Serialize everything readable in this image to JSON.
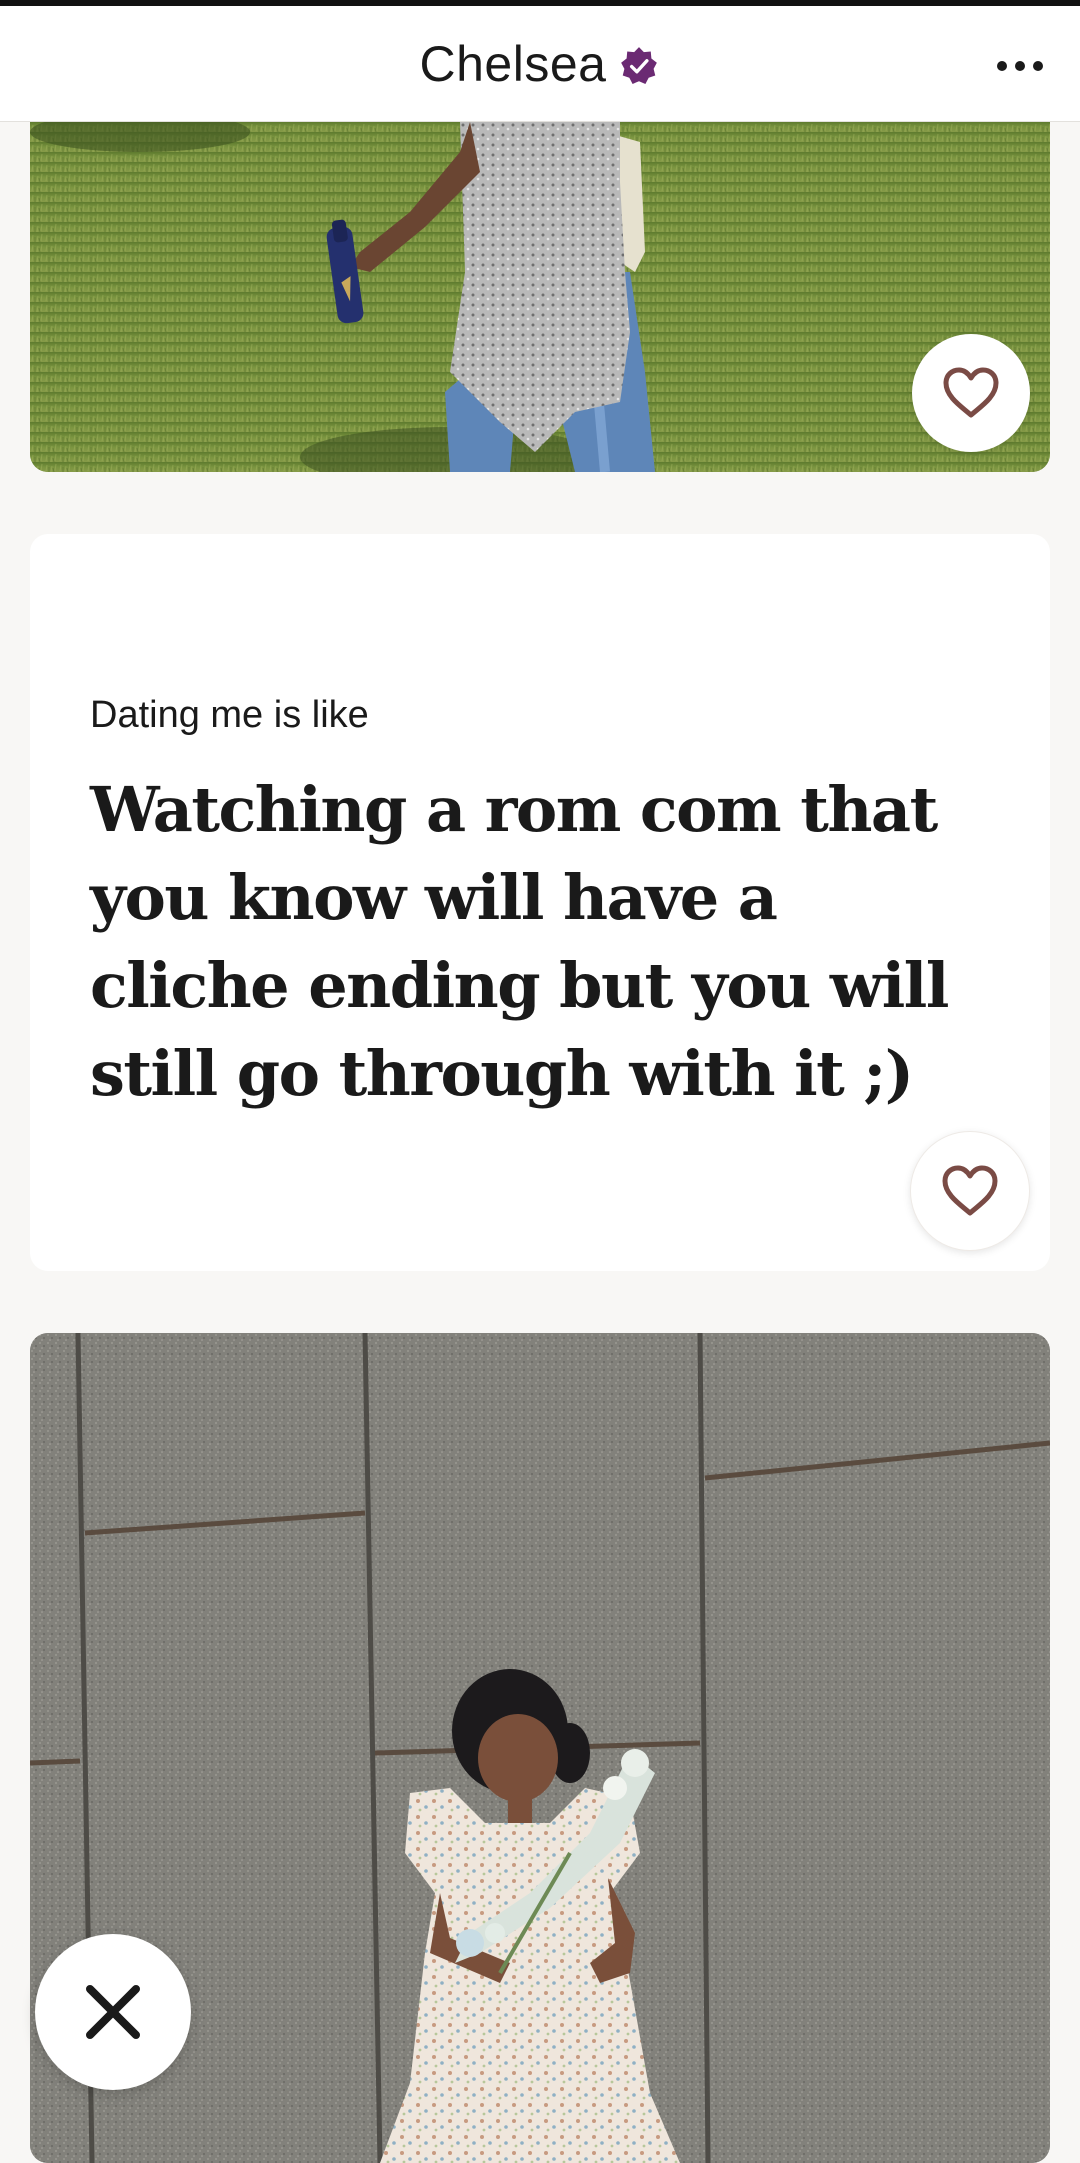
{
  "header": {
    "name": "Chelsea",
    "verified_icon": "verified-badge-icon",
    "more_icon": "more-dots-icon"
  },
  "photos": [
    {
      "name": "photo-1",
      "alt": "",
      "like_icon": "heart-icon"
    },
    {
      "name": "photo-2",
      "alt": "",
      "like_icon": "heart-icon"
    }
  ],
  "prompt": {
    "label": "Dating me is like",
    "answer": "Watching a rom com that you know will have a cliche ending but you will still go through with it ;)",
    "like_icon": "heart-icon"
  },
  "actions": {
    "pass_icon": "close-icon"
  },
  "colors": {
    "accent_purple": "#6b2a73",
    "heart_outline": "#7a4b45",
    "text_primary": "#1a1a1a",
    "page_bg": "#f8f7f5"
  }
}
